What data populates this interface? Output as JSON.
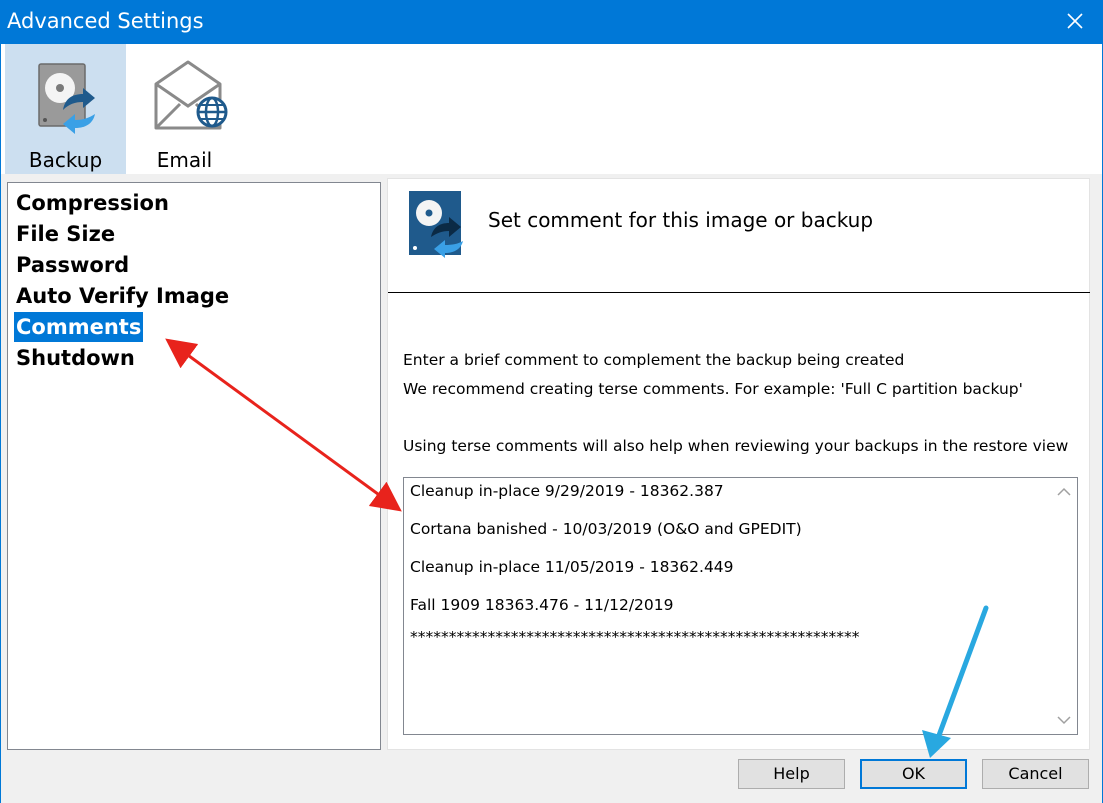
{
  "window": {
    "title": "Advanced Settings"
  },
  "toolbar": {
    "items": [
      {
        "label": "Backup",
        "icon": "backup-disk-icon",
        "selected": true
      },
      {
        "label": "Email",
        "icon": "email-globe-icon",
        "selected": false
      }
    ]
  },
  "sidebar": {
    "items": [
      {
        "label": "Compression"
      },
      {
        "label": "File Size"
      },
      {
        "label": "Password"
      },
      {
        "label": "Auto Verify Image"
      },
      {
        "label": "Comments",
        "selected": true
      },
      {
        "label": "Shutdown"
      }
    ]
  },
  "main": {
    "heading": "Set comment for this image or backup",
    "description": [
      "Enter a brief comment to complement the backup being created",
      "We recommend creating terse comments. For example: 'Full C partition backup'",
      "Using terse comments will also help when reviewing your backups in the restore view"
    ],
    "comments": [
      "Cleanup in-place 9/29/2019 - 18362.387",
      "Cortana  banished - 10/03/2019  (O&O and GPEDIT)",
      "Cleanup in-place 11/05/2019 - 18362.449",
      "Fall 1909 18363.476 - 11/12/2019",
      "**********************************************************"
    ]
  },
  "buttons": {
    "help": "Help",
    "ok": "OK",
    "cancel": "Cancel"
  },
  "colors": {
    "titlebar": "#0078d7",
    "selection": "#0078d7",
    "toolbar_selected": "#ccdff0",
    "annotation_red": "#e8231c",
    "annotation_blue": "#29a8e0"
  }
}
